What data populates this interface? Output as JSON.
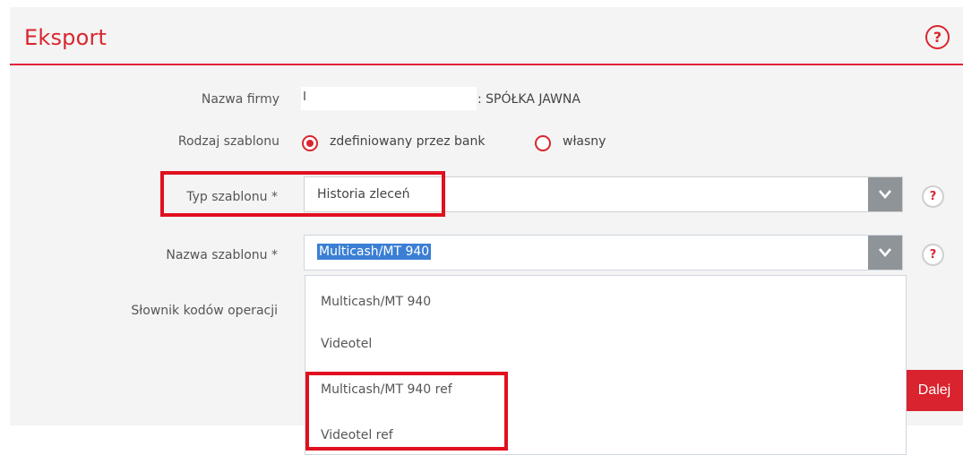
{
  "header": {
    "title": "Eksport",
    "help_symbol": "?"
  },
  "form": {
    "company_label": "Nazwa firmy",
    "company_value": ": SPÓŁKA JAWNA",
    "template_kind_label": "Rodzaj szablonu",
    "template_kind_options": [
      "zdefiniowany przez bank",
      "własny"
    ],
    "template_kind_selected": "zdefiniowany przez bank",
    "template_type_label": "Typ szablonu *",
    "template_type_value": "Historia zleceń",
    "template_name_label": "Nazwa szablonu *",
    "template_name_value": "Multicash/MT 940",
    "operation_codes_label": "Słownik kodów operacji",
    "help_symbol": "?"
  },
  "dropdown": {
    "options": [
      "Multicash/MT 940",
      "Videotel",
      "Multicash/MT 940 ref",
      "Videotel ref"
    ]
  },
  "actions": {
    "next_label": "Dalej"
  },
  "colors": {
    "accent": "#d9262e",
    "highlight": "#e0101e",
    "selection": "#3b7fd4"
  },
  "icons": {
    "help": "help-icon",
    "dropdown_arrow": "chevron-down-icon"
  }
}
